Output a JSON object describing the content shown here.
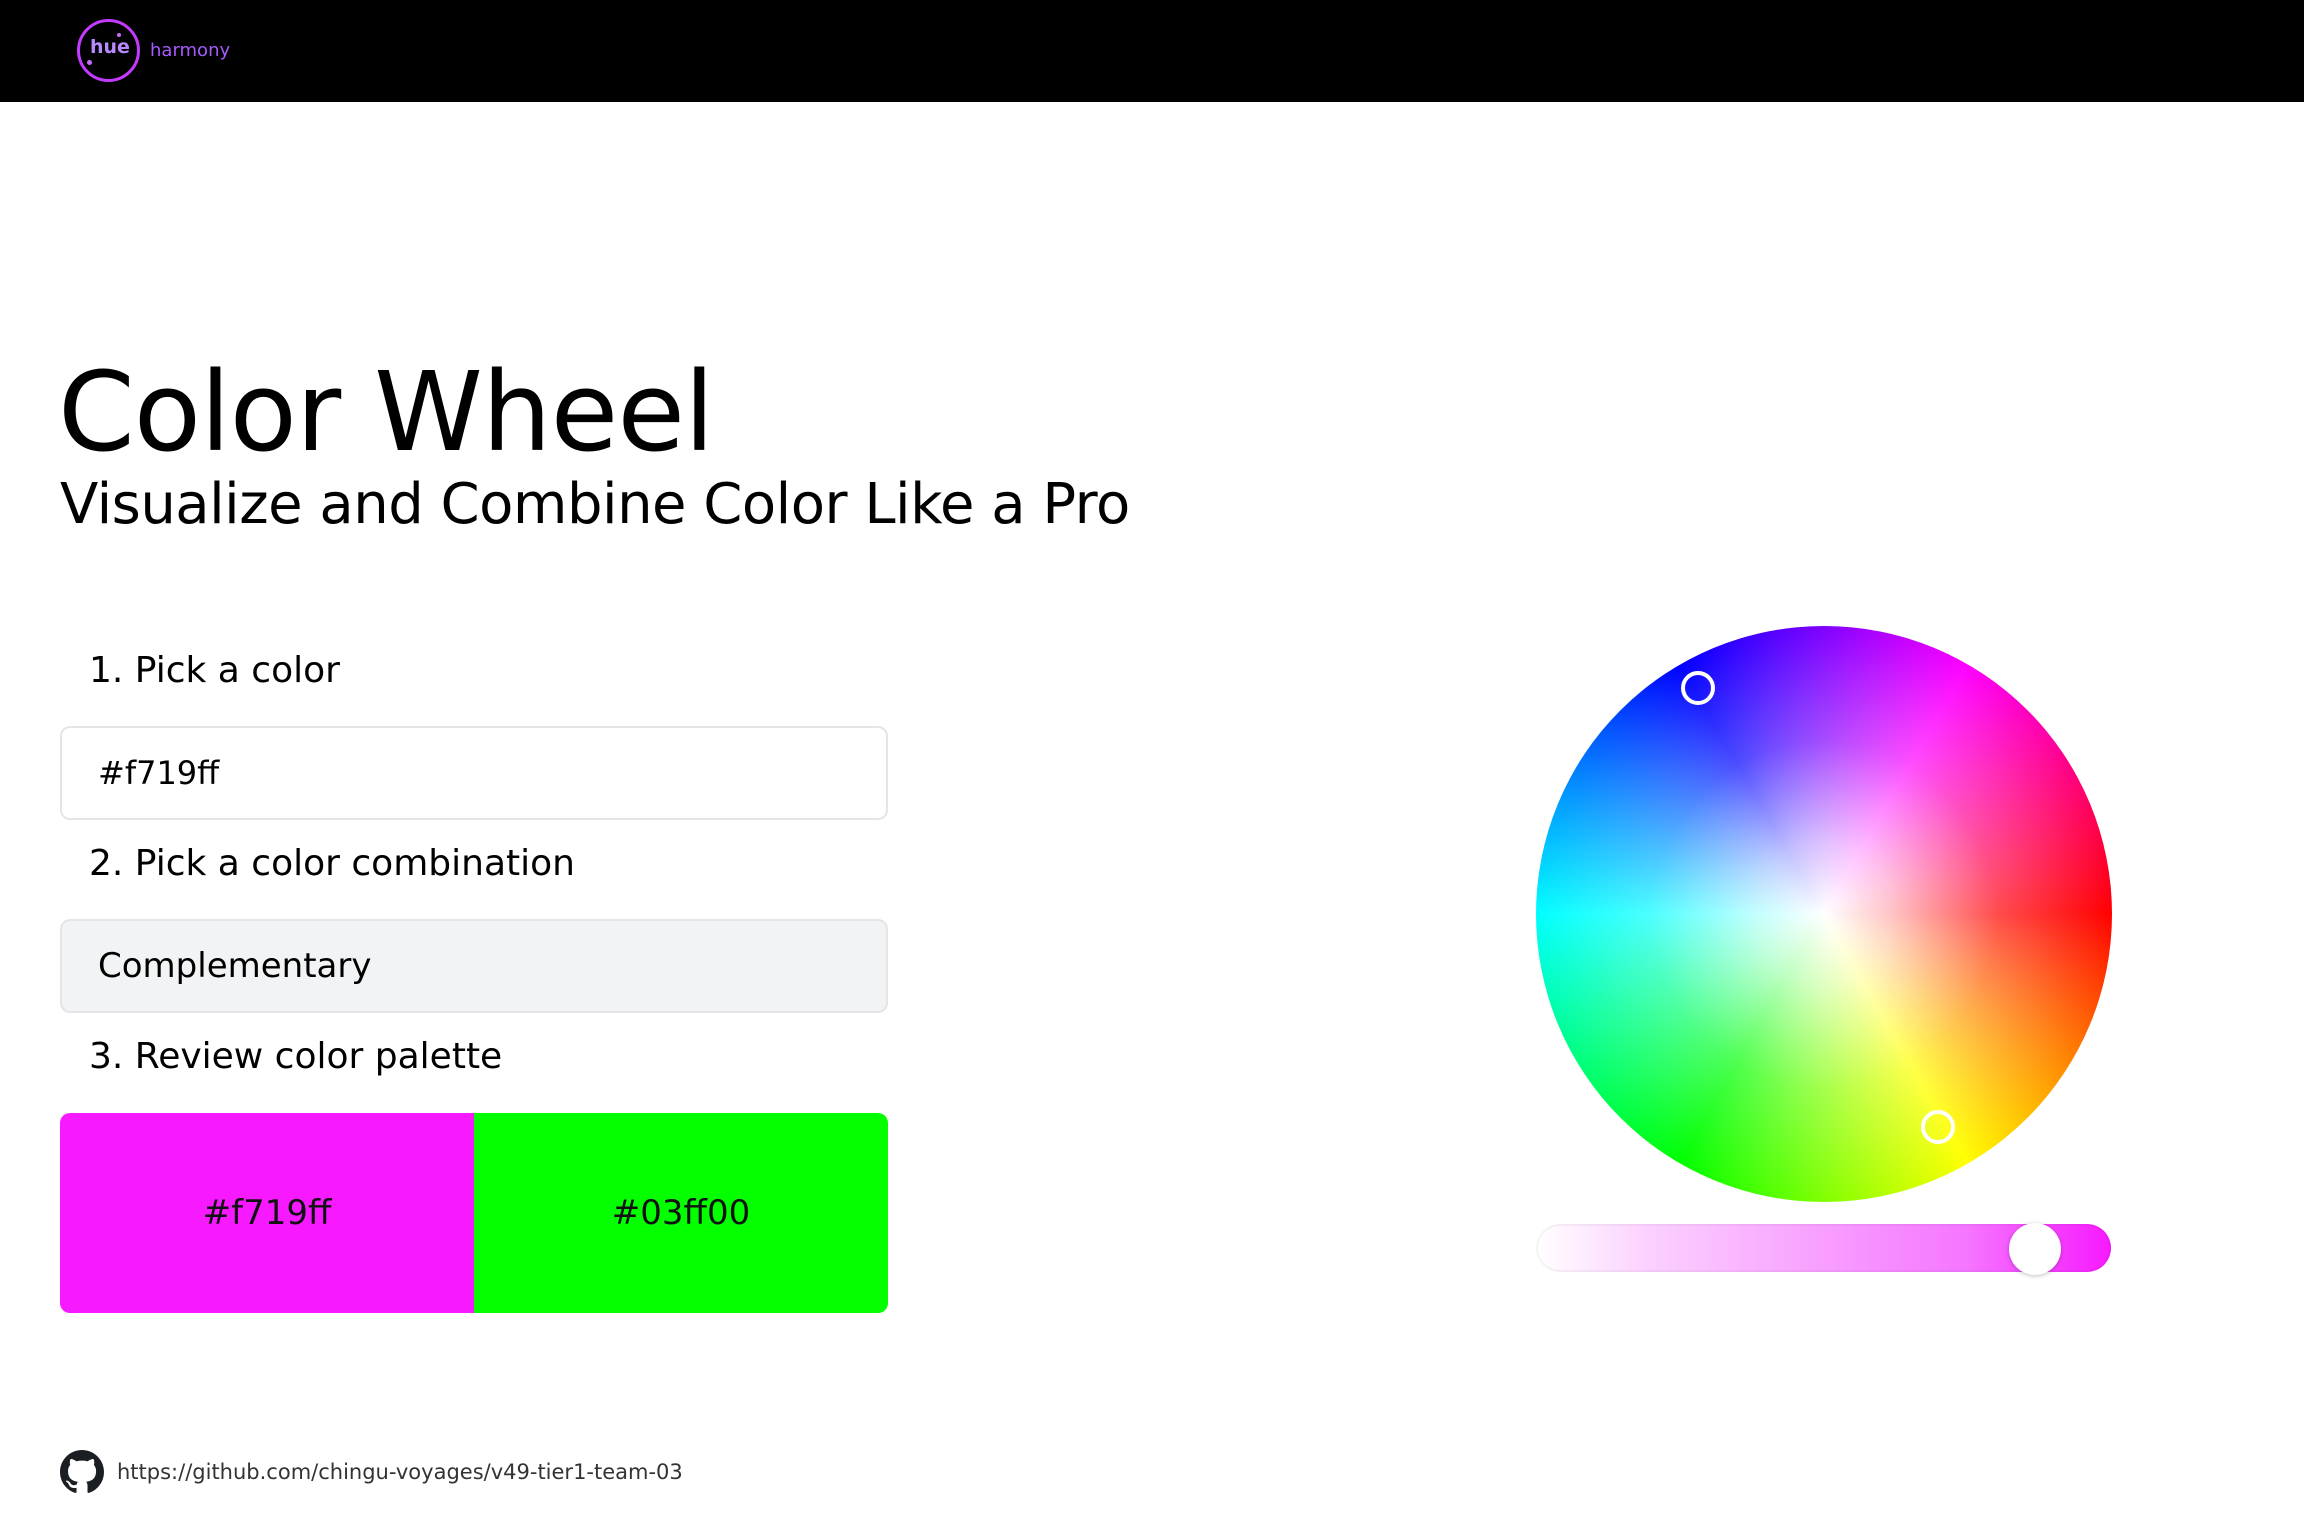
{
  "header": {
    "logo_hue": "hue",
    "logo_harmony": "harmony"
  },
  "main": {
    "title": "Color Wheel",
    "subtitle": "Visualize and Combine Color Like a Pro",
    "steps": {
      "pick_color": "1. Pick a color",
      "pick_combination": "2. Pick a color combination",
      "review_palette": "3. Review color palette"
    },
    "color_input": {
      "value": "#f719ff"
    },
    "combination": {
      "selected": "Complementary"
    },
    "palette": [
      {
        "hex": "#f719ff",
        "color": "#f719ff"
      },
      {
        "hex": "#03ff00",
        "color": "#03ff00"
      }
    ]
  },
  "wheel": {
    "icons": [
      "color-wheel",
      "selector-handle"
    ]
  },
  "footer": {
    "repo_url": "https://github.com/chingu-voyages/v49-tier1-team-03",
    "icon": "github-icon"
  },
  "colors": {
    "accent": "#c53aff",
    "primary_swatch": "#f719ff",
    "complement_swatch": "#03ff00"
  }
}
